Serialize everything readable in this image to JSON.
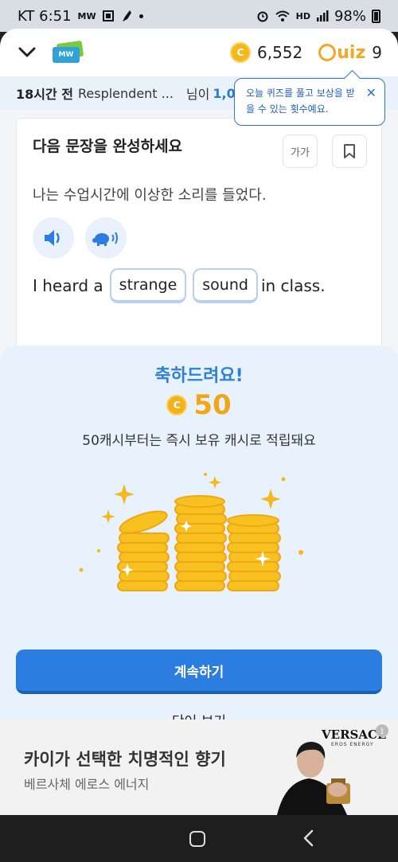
{
  "status_bar": {
    "carrier_time": "KT 6:51",
    "small_label": "MW",
    "battery": "98%",
    "hd": "HD"
  },
  "header": {
    "logo_text": "MW",
    "coin_symbol": "C",
    "cash": "6,552",
    "quiz_label": "uiz",
    "quiz_count": "9"
  },
  "ticker": {
    "time": "18시간 전",
    "text": "Resplendent ...",
    "suffix": "님이",
    "amount": "1,0"
  },
  "tooltip": {
    "text": "오늘 퀴즈를 풀고 보상을 받을 수 있는 횟수예요.",
    "close": "✕"
  },
  "quiz_card": {
    "title": "다음 문장을 완성하세요",
    "font_size_label": "가가",
    "sentence_ko": "나는 수업시간에 이상한 소리를 들었다.",
    "sentence_prefix": "I heard a",
    "words": [
      "strange",
      "sound"
    ],
    "sentence_suffix": "in class."
  },
  "reward_sheet": {
    "title": "축하드려요!",
    "coin_symbol": "C",
    "amount": "50",
    "description": "50캐시부터는 즉시 보유 캐시로 적립돼요",
    "continue_label": "계속하기",
    "word_view_label": "단어 보기"
  },
  "ad": {
    "title": "카이가 선택한 치명적인 향기",
    "subtitle": "베르사체 에로스 에너지",
    "brand": "VERSACE",
    "brand_sub": "EROS ENERGY",
    "info": "i"
  },
  "colors": {
    "accent": "#2b7de0",
    "coin": "#f4b21a",
    "quiz": "#f5a623"
  }
}
